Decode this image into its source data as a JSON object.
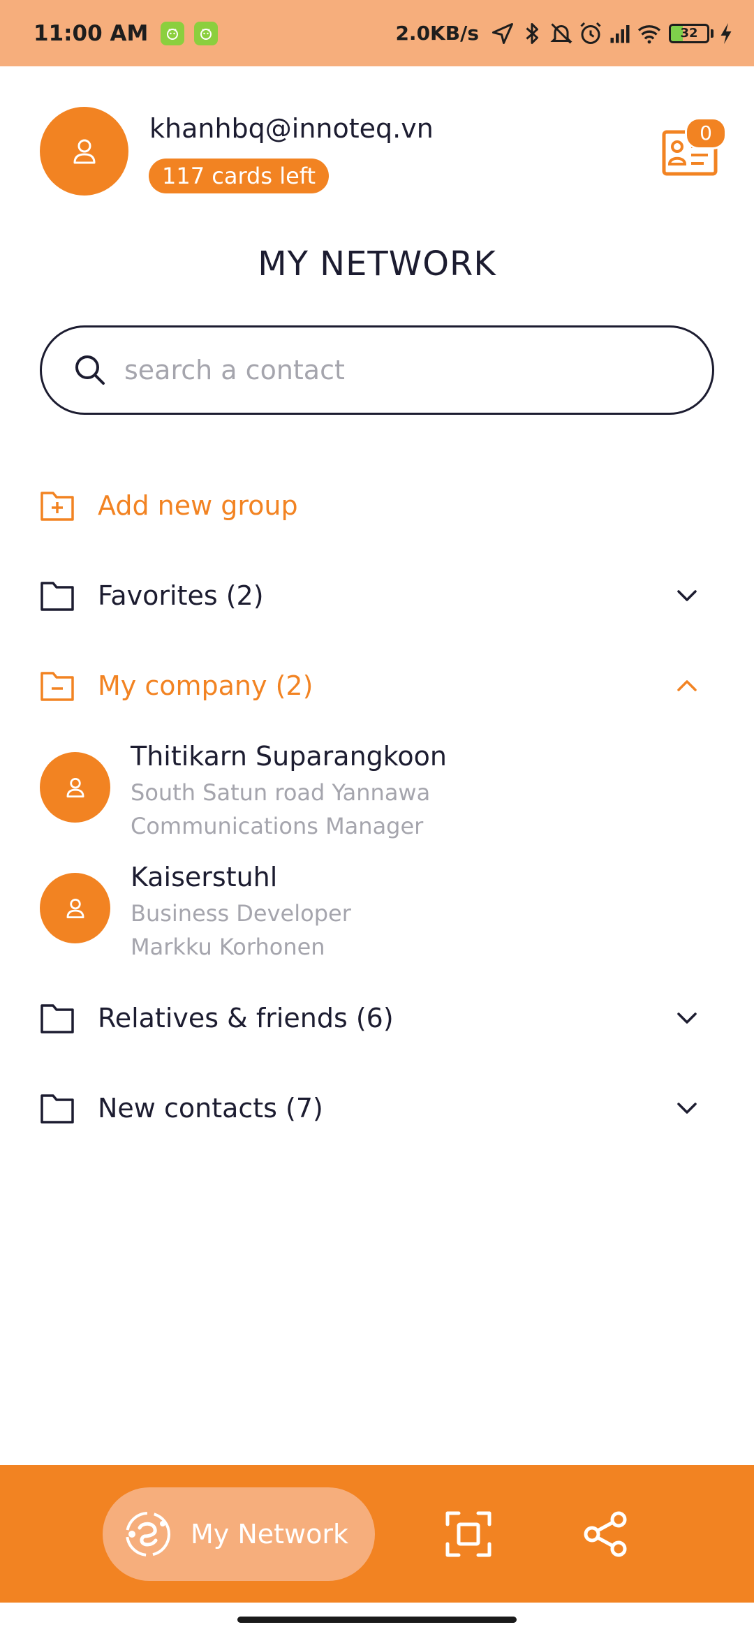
{
  "status_bar": {
    "time": "11:00 AM",
    "network_speed": "2.0KB/s",
    "battery_level": "32",
    "battery_percent": 32
  },
  "header": {
    "email": "khanhbq@innoteq.vn",
    "cards_left": "117 cards left",
    "card_count": "0"
  },
  "page_title": "MY NETWORK",
  "search": {
    "placeholder": "search a contact",
    "value": ""
  },
  "add_group_label": "Add new group",
  "groups": [
    {
      "label": "Favorites (2)",
      "expanded": false
    },
    {
      "label": "My company (2)",
      "expanded": true
    },
    {
      "label": "Relatives & friends (6)",
      "expanded": false
    },
    {
      "label": "New contacts (7)",
      "expanded": false
    }
  ],
  "contacts": [
    {
      "name": "Thitikarn Suparangkoon",
      "line1": "South Satun road Yannawa",
      "line2": "Communications Manager"
    },
    {
      "name": "Kaiserstuhl",
      "line1": "Business Developer",
      "line2": "Markku Korhonen"
    }
  ],
  "bottom_nav": {
    "active_label": "My Network",
    "items": [
      "my-network",
      "scan",
      "share"
    ]
  },
  "colors": {
    "accent": "#f28322",
    "accent_light": "#f6ae7c",
    "text_dark": "#1c1c30",
    "text_muted": "#a5a5ad"
  }
}
